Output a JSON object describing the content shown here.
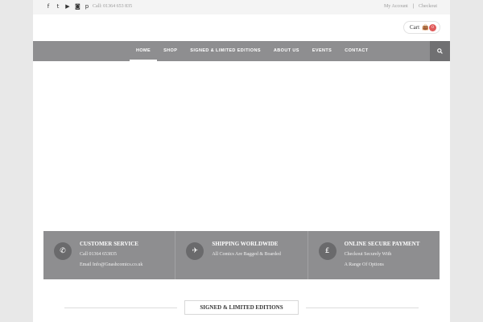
{
  "topbar": {
    "social_icons": [
      "facebook-icon",
      "twitter-icon",
      "youtube-icon",
      "instagram-icon",
      "pinterest-icon"
    ],
    "social_glyphs": [
      "f",
      "t",
      "▶",
      "◙",
      "p"
    ],
    "phone": "Call: 01364 653 835",
    "my_account": "My Account",
    "separator": "|",
    "checkout": "Checkout"
  },
  "cart": {
    "label": "Cart",
    "bag_glyph": "👜",
    "count": "0"
  },
  "nav": {
    "items": [
      {
        "label": "HOME",
        "active": true
      },
      {
        "label": "SHOP",
        "active": false
      },
      {
        "label": "SIGNED & LIMITED EDITIONS",
        "active": false
      },
      {
        "label": "ABOUT US",
        "active": false
      },
      {
        "label": "EVENTS",
        "active": false
      },
      {
        "label": "CONTACT",
        "active": false
      }
    ]
  },
  "services": [
    {
      "icon": "phone-icon",
      "glyph": "✆",
      "title": "CUSTOMER SERVICE",
      "line1": "Call 01364 653835",
      "line2": "Email Info@Gnashcomics.co.uk"
    },
    {
      "icon": "airplane-icon",
      "glyph": "✈",
      "title": "SHIPPING WORLDWIDE",
      "line1": "All Comics Are Bagged & Boarded",
      "line2": ""
    },
    {
      "icon": "pound-icon",
      "glyph": "£",
      "title": "ONLINE SECURE PAYMENT",
      "line1": "Checkout Securely With",
      "line2": "A Range Of Options"
    }
  ],
  "section": {
    "title": "SIGNED & LIMITED EDITIONS"
  },
  "colors": {
    "nav_bg": "#8e8e90",
    "search_bg": "#707072",
    "badge": "#e05a5a"
  }
}
